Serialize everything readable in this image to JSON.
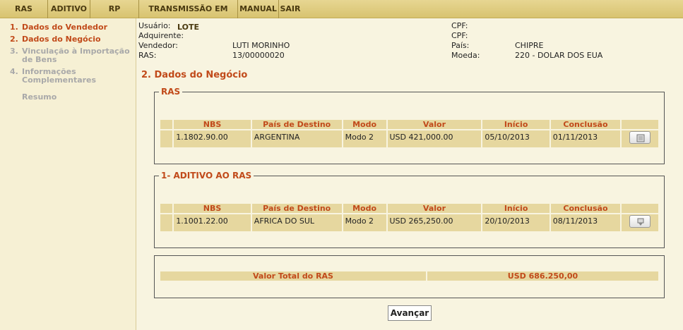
{
  "nav": [
    {
      "label": "RAS"
    },
    {
      "label": "ADITIVO"
    },
    {
      "label": "RP"
    },
    {
      "label": "TRANSMISSÃO EM LOTE"
    },
    {
      "label": "MANUAL"
    },
    {
      "label": "SAIR"
    }
  ],
  "sidebar": {
    "steps": [
      {
        "num": "1.",
        "label": "Dados do Vendedor",
        "label2": "",
        "state": "active"
      },
      {
        "num": "2.",
        "label": "Dados do Negócio",
        "label2": "",
        "state": "active"
      },
      {
        "num": "3.",
        "label": "Vinculação à Importação",
        "label2": "de Bens",
        "state": "inactive"
      },
      {
        "num": "4.",
        "label": "Informações",
        "label2": "Complementares",
        "state": "inactive"
      },
      {
        "num": "",
        "label": "Resumo",
        "label2": "",
        "state": "inactive"
      }
    ]
  },
  "info": {
    "usuario_label": "Usuário:",
    "usuario_value": "",
    "adquirente_label": "Adquirente:",
    "adquirente_value": "",
    "vendedor_label": "Vendedor:",
    "vendedor_value": "LUTI MORINHO",
    "ras_label": "RAS:",
    "ras_value": "13/00000020",
    "cpf1_label": "CPF:",
    "cpf1_value": "",
    "cpf2_label": "CPF:",
    "cpf2_value": "",
    "pais_label": "País:",
    "pais_value": "CHIPRE",
    "moeda_label": "Moeda:",
    "moeda_value": "220 - DOLAR DOS EUA"
  },
  "section_title": "2. Dados do Negócio",
  "ras_box": {
    "legend": "RAS",
    "headers": [
      "NBS",
      "País de Destino",
      "Modo",
      "Valor",
      "Início",
      "Conclusão"
    ],
    "row": {
      "nbs": "1.1802.90.00",
      "pais": "ARGENTINA",
      "modo": "Modo 2",
      "valor": "USD 421,000.00",
      "inicio": "05/10/2013",
      "conclusao": "01/11/2013"
    }
  },
  "aditivo_box": {
    "legend": "1- ADITIVO AO RAS",
    "headers": [
      "NBS",
      "País de Destino",
      "Modo",
      "Valor",
      "Início",
      "Conclusão"
    ],
    "row": {
      "nbs": "1.1001.22.00",
      "pais": "AFRICA DO SUL",
      "modo": "Modo 2",
      "valor": "USD 265,250.00",
      "inicio": "20/10/2013",
      "conclusao": "08/11/2013"
    }
  },
  "total": {
    "label": "Valor Total do RAS",
    "value": "USD 686.250,00"
  },
  "advance_label": "Avançar",
  "colors": {
    "accent": "#c14a1a",
    "nav_bg": "#dcc87a",
    "cell_bg": "#e6d79f",
    "page_bg": "#f8f4e0"
  },
  "icons": {
    "ras_row_action": "document-icon",
    "aditivo_row_action": "document-down-icon"
  }
}
